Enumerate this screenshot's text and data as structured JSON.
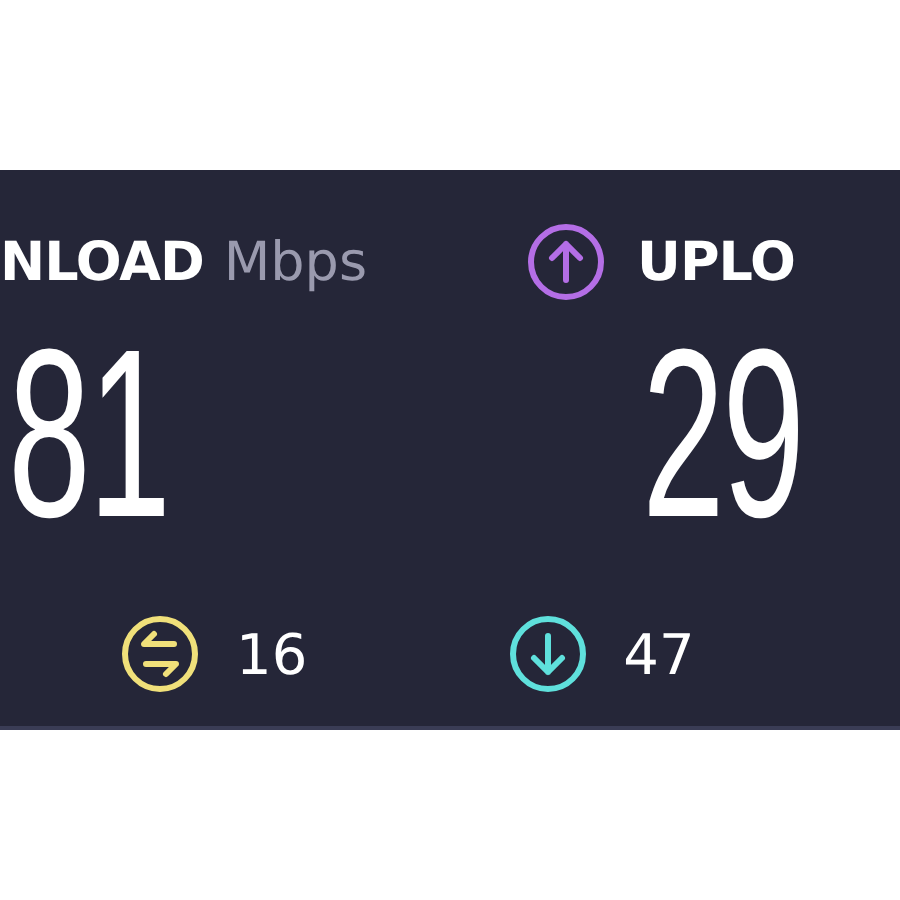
{
  "download": {
    "label": "NLOAD",
    "unit": "Mbps",
    "value": "81"
  },
  "upload": {
    "label": "UPLO",
    "value": "29"
  },
  "stats": [
    {
      "kind": "ping",
      "value": "16",
      "color": "#f0e07a"
    },
    {
      "kind": "download",
      "value": "47",
      "color": "#5fe0dc"
    }
  ]
}
